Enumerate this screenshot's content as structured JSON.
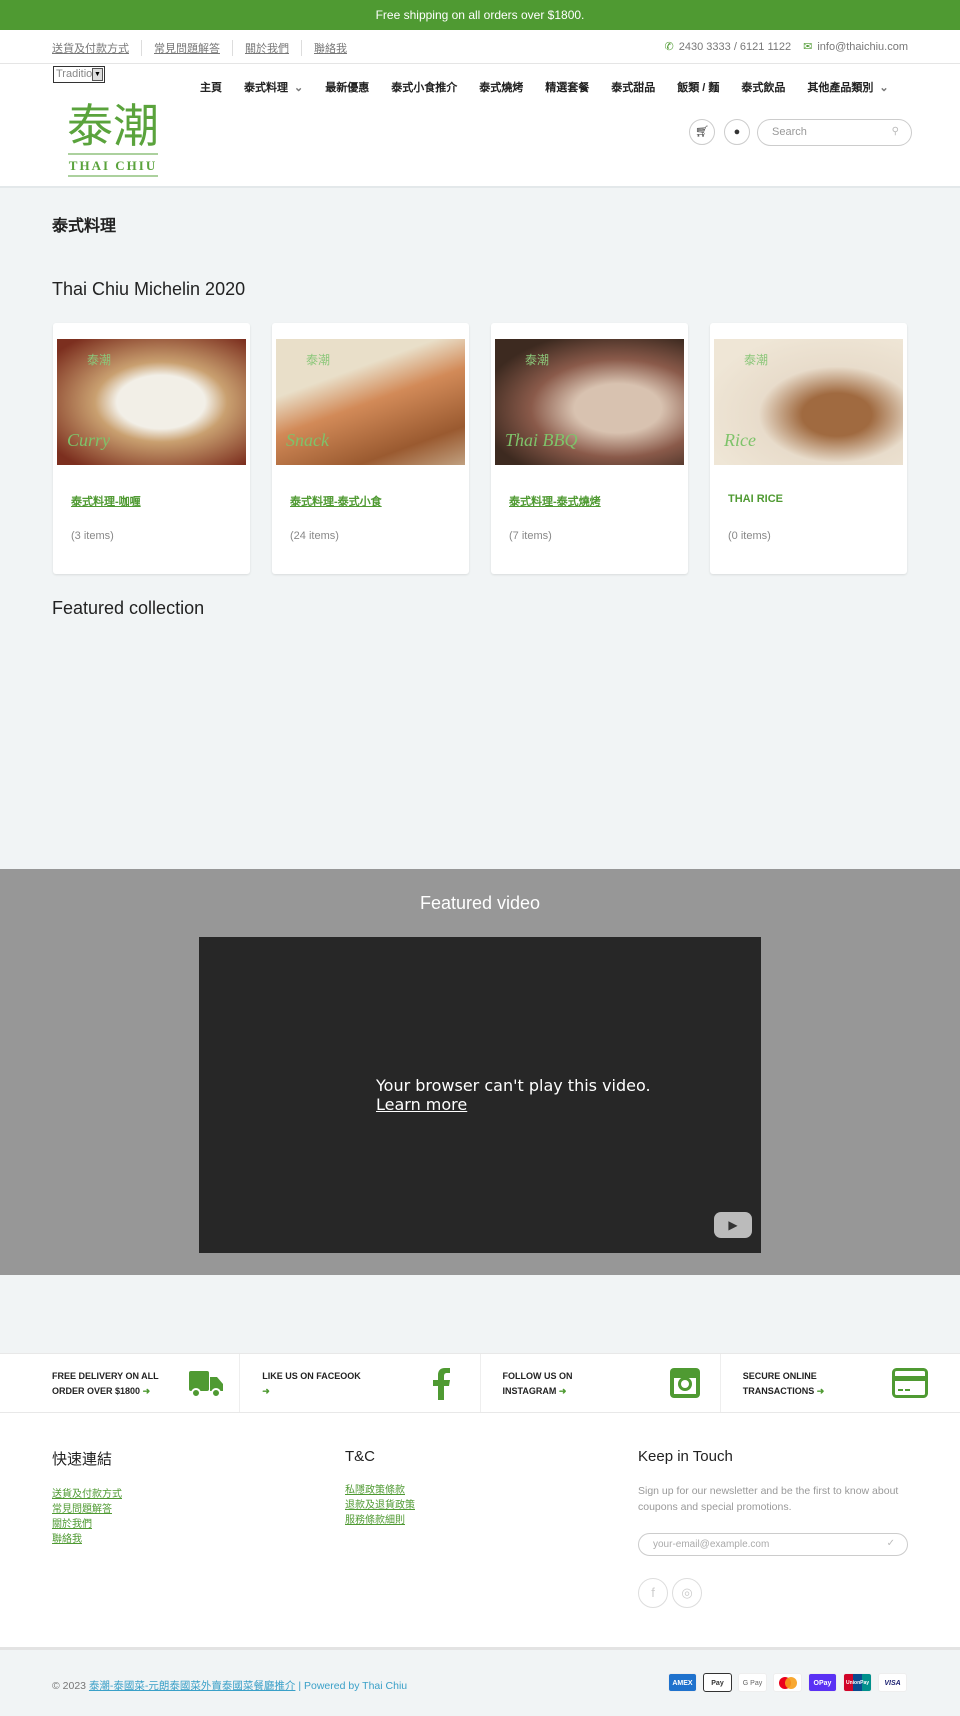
{
  "promo": "Free shipping on all orders over $1800.",
  "toplinks": [
    "送貨及付款方式",
    "常見問題解答",
    "關於我們",
    "聯絡我"
  ],
  "contact": {
    "phone": "2430 3333 / 6121 1122",
    "email": "info@thaichiu.com"
  },
  "language": "Traditio",
  "logo": {
    "cn": "泰潮",
    "en": "THAI CHIU"
  },
  "nav": [
    {
      "label": "主頁"
    },
    {
      "label": "泰式料理",
      "dropdown": true
    },
    {
      "label": "最新優惠"
    },
    {
      "label": "泰式小食推介"
    },
    {
      "label": "泰式燒烤"
    },
    {
      "label": "精選套餐"
    },
    {
      "label": "泰式甜品"
    },
    {
      "label": "飯類 / 麵"
    },
    {
      "label": "泰式飲品"
    },
    {
      "label": "其他產品類別",
      "dropdown": true
    }
  ],
  "search": {
    "placeholder": "Search"
  },
  "page_title": "泰式料理",
  "collections_title": "Thai Chiu Michelin 2020",
  "cards": [
    {
      "img_label": "Curry",
      "name": "泰式料理-咖喱",
      "count": "(3 items)"
    },
    {
      "img_label": "Snack",
      "name": "泰式料理-泰式小食",
      "count": "(24 items)"
    },
    {
      "img_label": "Thai BBQ",
      "name": "泰式料理-泰式燒烤",
      "count": "(7 items)"
    },
    {
      "img_label": "Rice",
      "name": "THAI RICE",
      "count": "(0 items)"
    }
  ],
  "featured_collection": "Featured collection",
  "video": {
    "title": "Featured video",
    "message": "Your browser can't play this video.",
    "link": "Learn more"
  },
  "features": [
    {
      "line1": "FREE DELIVERY ON ALL",
      "line2": "ORDER OVER $1800",
      "icon": "truck-icon"
    },
    {
      "line1": "LIKE US ON FACEOOK",
      "line2": "",
      "icon": "facebook-icon"
    },
    {
      "line1": "FOLLOW US ON",
      "line2": "INSTAGRAM",
      "icon": "instagram-icon"
    },
    {
      "line1": "SECURE ONLINE",
      "line2": "TRANSACTIONS",
      "icon": "credit-card-icon"
    }
  ],
  "footer": {
    "col1": {
      "title": "快速連結",
      "links": [
        "送貨及付款方式",
        "常見問題解答",
        "關於我們",
        "聯絡我"
      ]
    },
    "col2": {
      "title": "T&C",
      "links": [
        "私隱政策條款",
        "退款及退貨政策",
        "服務條款細則"
      ]
    },
    "col3": {
      "title": "Keep in Touch",
      "text": "Sign up for our newsletter and be the first to know about coupons and special promotions.",
      "email_placeholder": "your-email@example.com"
    }
  },
  "copyright": {
    "prefix": "© 2023",
    "shop": "泰潮-泰國菜-元朗泰國菜外賣泰國菜餐廳推介",
    "powered": "| Powered by Thai Chiu"
  },
  "payments": [
    "AMEX",
    "Pay",
    "G Pay",
    "Mastercard",
    "OPay",
    "UnionPay",
    "VISA"
  ],
  "colors": {
    "brand": "#4f9a32",
    "link": "#3aa0c8"
  }
}
